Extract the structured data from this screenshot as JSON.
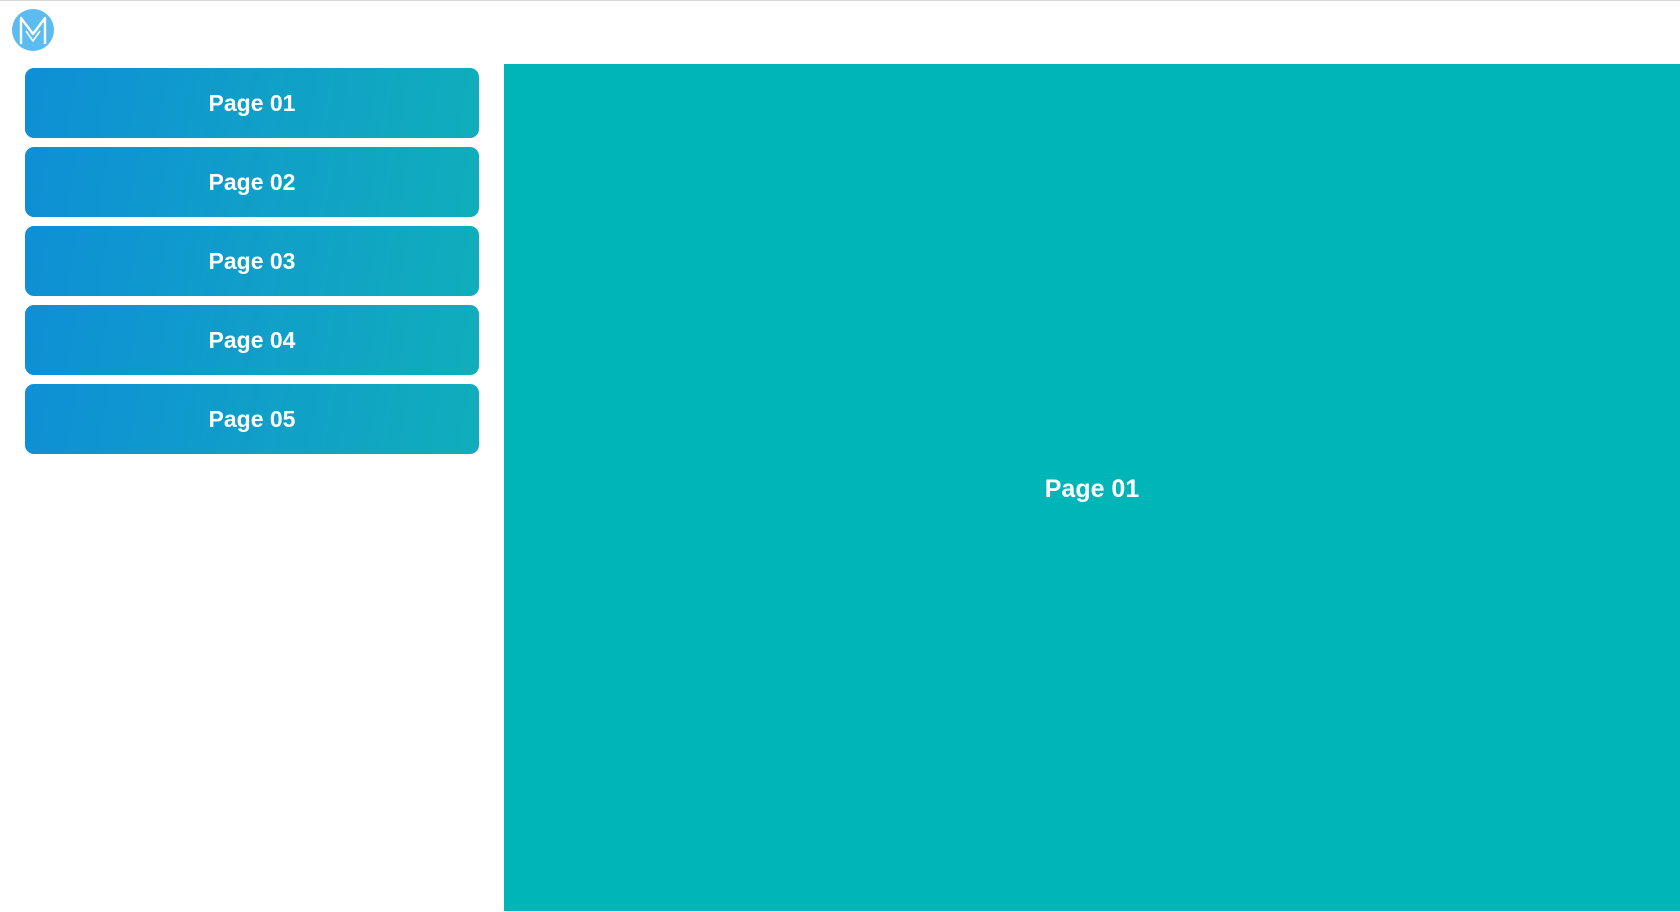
{
  "logo": {
    "icon": "m-logo-icon",
    "color": "#5cbcf0"
  },
  "sidebar": {
    "items": [
      {
        "label": "Page 01"
      },
      {
        "label": "Page 02"
      },
      {
        "label": "Page 03"
      },
      {
        "label": "Page 04"
      },
      {
        "label": "Page 05"
      }
    ],
    "gradient": [
      "#0f8fd6",
      "#10aebc"
    ]
  },
  "main": {
    "title": "Page 01",
    "background": "#00b5b8"
  }
}
